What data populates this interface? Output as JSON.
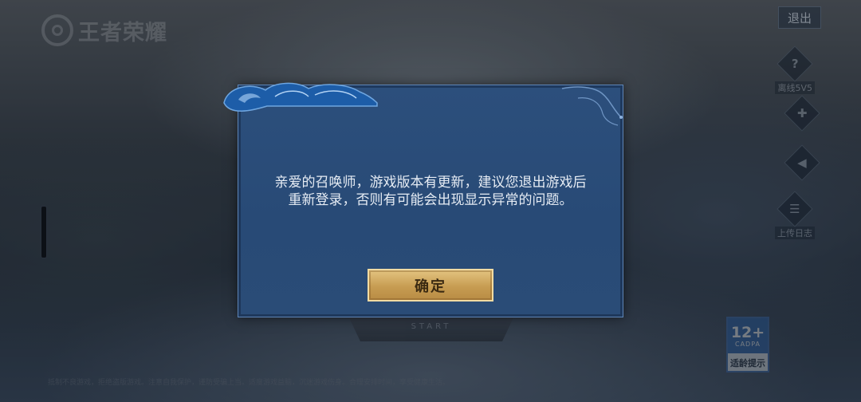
{
  "app": {
    "logo_text": "王者荣耀"
  },
  "header": {
    "exit_label": "退出"
  },
  "side_tools": [
    {
      "icon": "question-icon",
      "glyph": "?",
      "label": "离线5V5"
    },
    {
      "icon": "gamepad-icon",
      "glyph": "✚",
      "label": ""
    },
    {
      "icon": "speaker-icon",
      "glyph": "◀",
      "label": ""
    },
    {
      "icon": "log-upload-icon",
      "glyph": "☰",
      "label": "上传日志"
    }
  ],
  "start_plate": {
    "label": "START"
  },
  "age_rating": {
    "number": "12+",
    "org": "CADPA",
    "hint": "适龄提示"
  },
  "footer": {
    "text": "抵制不良游戏，拒绝盗版游戏。注意自我保护，谨防受骗上当。适度游戏益脑，沉迷游戏伤身。合理安排时间，享受健康生活。"
  },
  "dialog": {
    "message_line1": "亲爱的召唤师，游戏版本有更新，建议您退出游戏后",
    "message_line2": "重新登录，否则有可能会出现显示异常的问题。",
    "confirm_label": "确定"
  },
  "colors": {
    "dialog_bg": "#2a4c77",
    "dialog_border": "#5f86b8",
    "confirm_gold": "#c79c52"
  }
}
